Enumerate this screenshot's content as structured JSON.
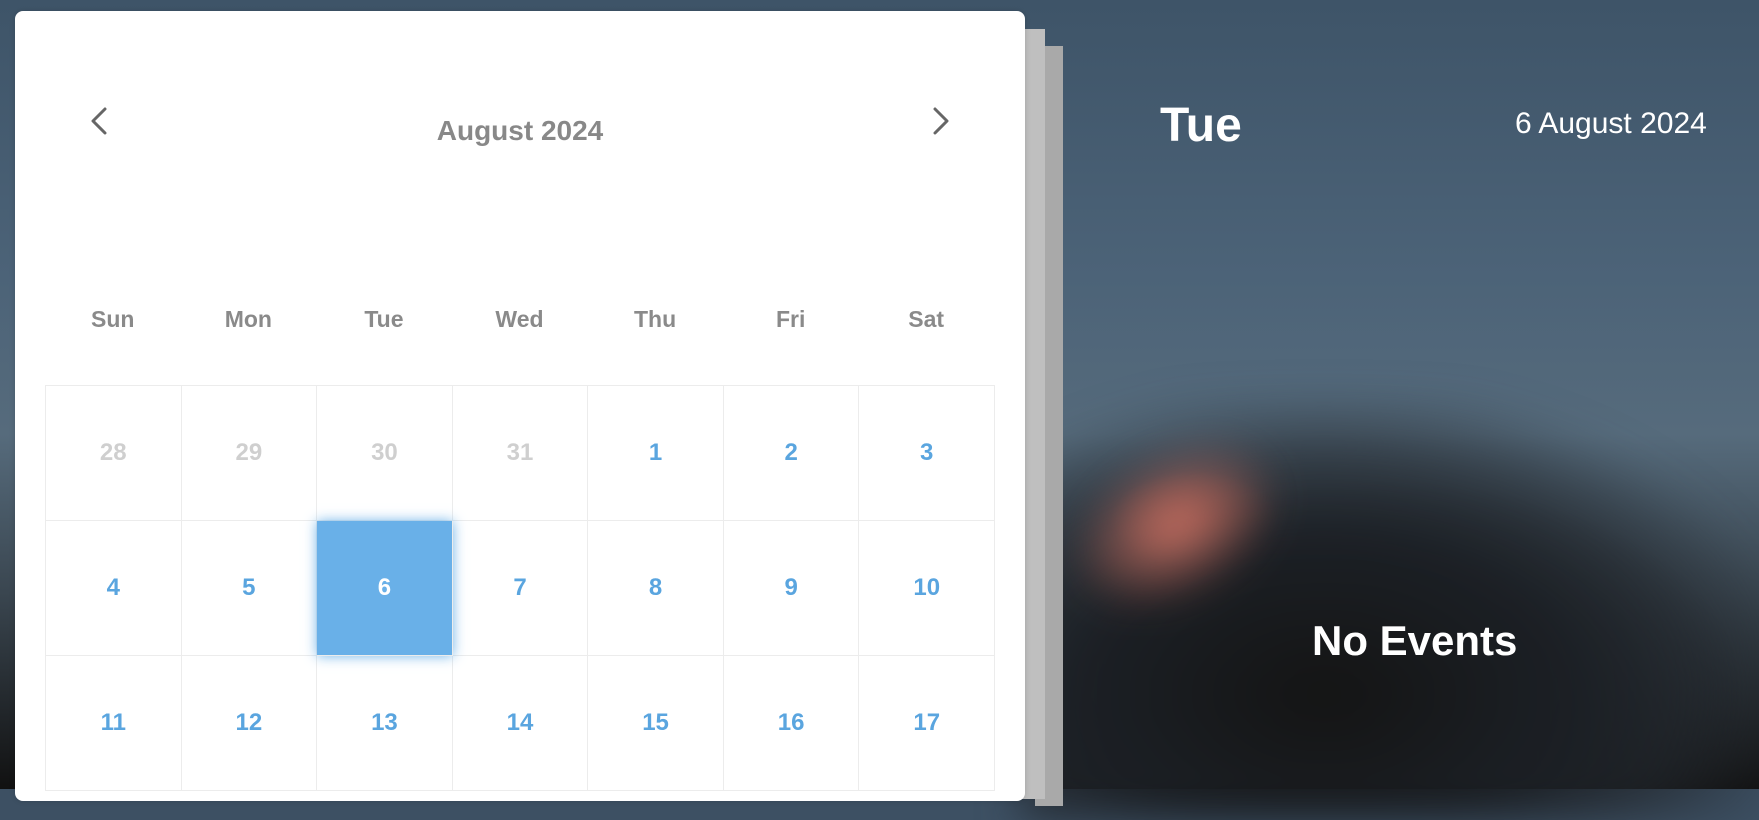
{
  "calendar": {
    "month_title": "August 2024",
    "weekdays": [
      "Sun",
      "Mon",
      "Tue",
      "Wed",
      "Thu",
      "Fri",
      "Sat"
    ],
    "days": [
      {
        "label": "28",
        "state": "muted"
      },
      {
        "label": "29",
        "state": "muted"
      },
      {
        "label": "30",
        "state": "muted"
      },
      {
        "label": "31",
        "state": "muted"
      },
      {
        "label": "1",
        "state": "normal"
      },
      {
        "label": "2",
        "state": "normal"
      },
      {
        "label": "3",
        "state": "normal"
      },
      {
        "label": "4",
        "state": "normal"
      },
      {
        "label": "5",
        "state": "normal"
      },
      {
        "label": "6",
        "state": "selected"
      },
      {
        "label": "7",
        "state": "normal"
      },
      {
        "label": "8",
        "state": "normal"
      },
      {
        "label": "9",
        "state": "normal"
      },
      {
        "label": "10",
        "state": "normal"
      },
      {
        "label": "11",
        "state": "normal"
      },
      {
        "label": "12",
        "state": "normal"
      },
      {
        "label": "13",
        "state": "normal"
      },
      {
        "label": "14",
        "state": "normal"
      },
      {
        "label": "15",
        "state": "normal"
      },
      {
        "label": "16",
        "state": "normal"
      },
      {
        "label": "17",
        "state": "normal"
      }
    ],
    "icons": {
      "prev": "chevron-left-icon",
      "next": "chevron-right-icon"
    },
    "colors": {
      "accent": "#5aa5df",
      "selected_bg": "#69b0e8",
      "muted": "#cfcfcf"
    }
  },
  "day_panel": {
    "weekday": "Tue",
    "date": "6 August 2024",
    "events_status": "No Events"
  }
}
